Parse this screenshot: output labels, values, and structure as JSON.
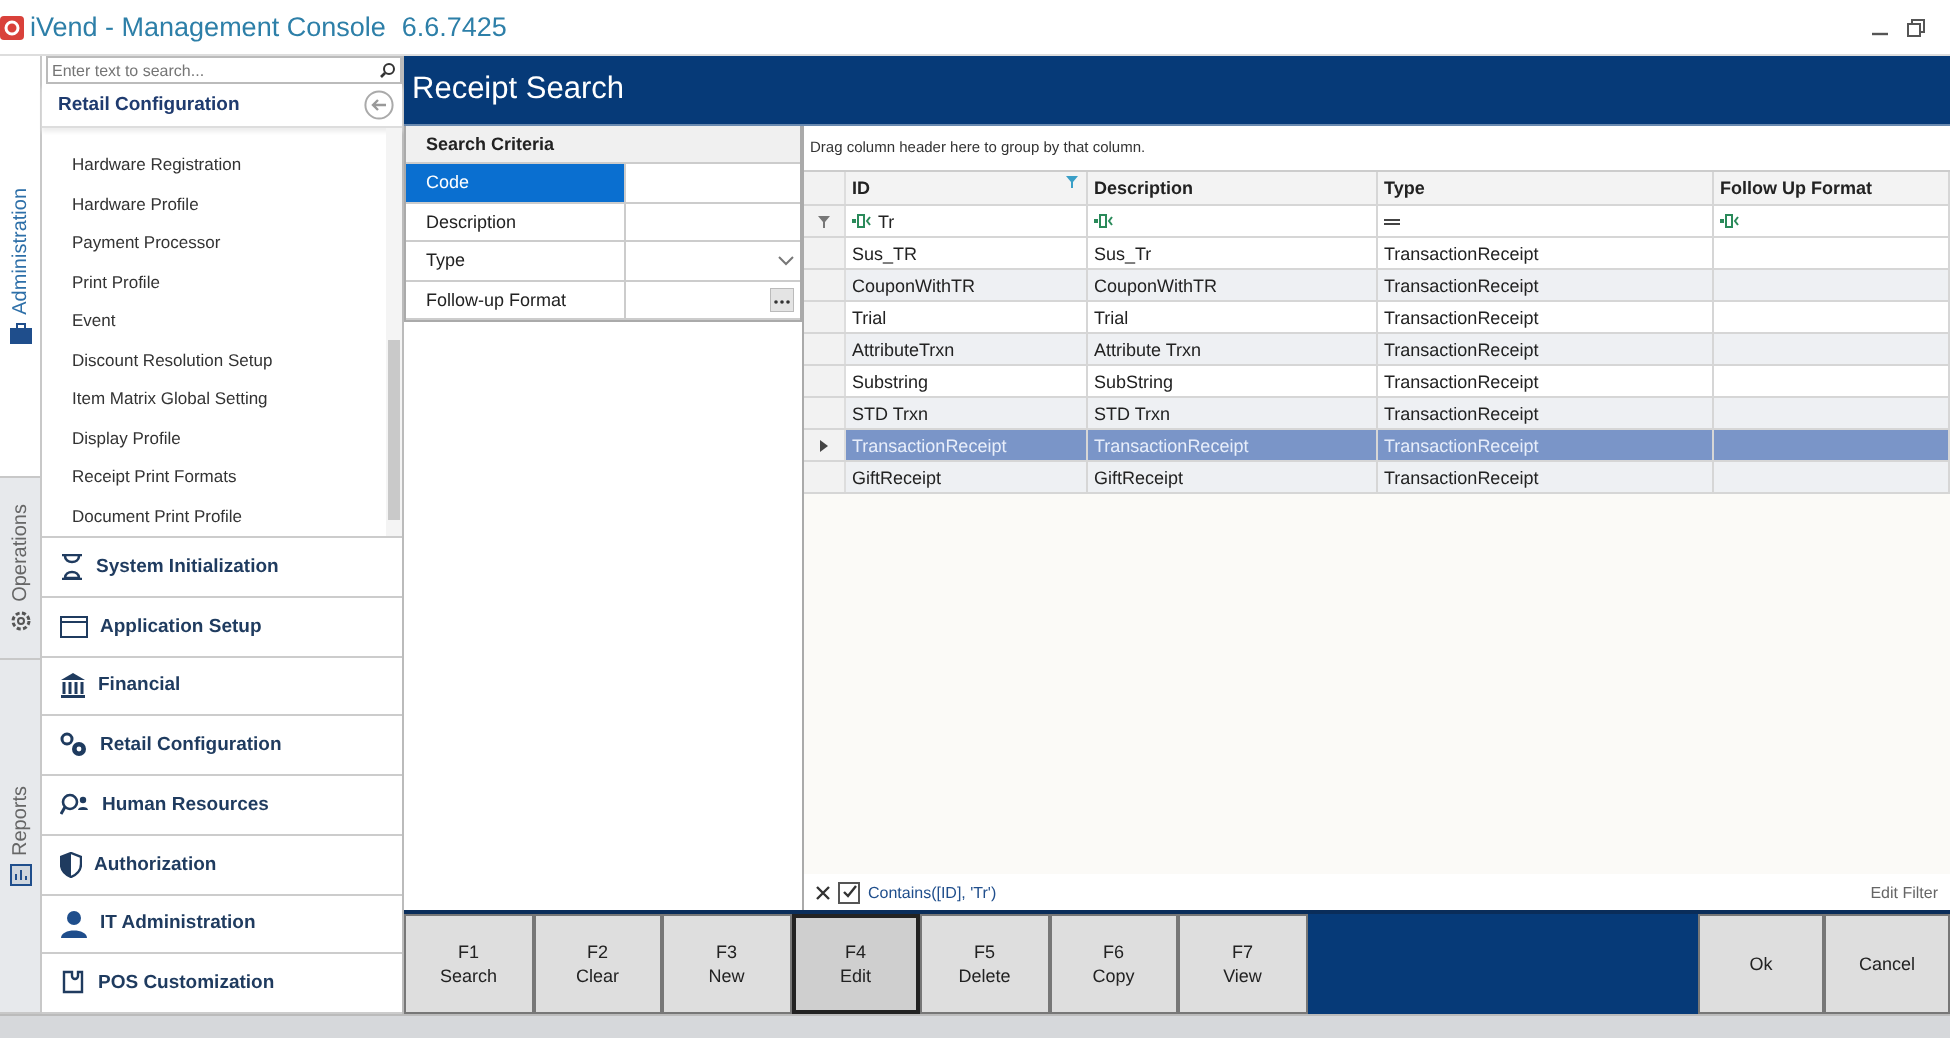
{
  "window": {
    "title": "iVend - Management Console",
    "version": "6.6.7425"
  },
  "side_tabs": [
    {
      "label": "Administration",
      "selected": true
    },
    {
      "label": "Operations",
      "selected": false
    },
    {
      "label": "Reports",
      "selected": false
    }
  ],
  "sidebar": {
    "search": {
      "placeholder": "Enter text to search..."
    },
    "section_title": "Retail Configuration",
    "items": [
      {
        "label": "Hardware Registration"
      },
      {
        "label": "Hardware Profile"
      },
      {
        "label": "Payment Processor"
      },
      {
        "label": "Print Profile"
      },
      {
        "label": "Event"
      },
      {
        "label": "Discount Resolution Setup"
      },
      {
        "label": "Item Matrix Global Setting"
      },
      {
        "label": "Display Profile"
      },
      {
        "label": "Receipt Print Formats"
      },
      {
        "label": "Document Print Profile"
      }
    ],
    "groups": [
      {
        "label": "System Initialization"
      },
      {
        "label": "Application Setup"
      },
      {
        "label": "Financial"
      },
      {
        "label": "Retail Configuration"
      },
      {
        "label": "Human Resources"
      },
      {
        "label": "Authorization"
      },
      {
        "label": "IT Administration"
      },
      {
        "label": "POS Customization"
      }
    ]
  },
  "page": {
    "title": "Receipt Search"
  },
  "criteria": {
    "title": "Search Criteria",
    "fields": [
      {
        "label": "Code",
        "kind": "text",
        "selected": true
      },
      {
        "label": "Description",
        "kind": "text",
        "selected": false
      },
      {
        "label": "Type",
        "kind": "dropdown",
        "selected": false
      },
      {
        "label": "Follow-up Format",
        "kind": "picker",
        "selected": false
      }
    ]
  },
  "grid": {
    "group_hint": "Drag column header here to group by that column.",
    "columns": [
      {
        "label": "ID",
        "filtered": true
      },
      {
        "label": "Description",
        "filtered": false
      },
      {
        "label": "Type",
        "filtered": false
      },
      {
        "label": "Follow Up Format",
        "filtered": false
      }
    ],
    "filter_row": [
      {
        "kind": "contains",
        "value": "Tr"
      },
      {
        "kind": "contains"
      },
      {
        "kind": "equals"
      },
      {
        "kind": "contains"
      }
    ],
    "rows": [
      {
        "id": "Sus_TR",
        "description": "Sus_Tr",
        "type": "TransactionReceipt",
        "selected": false
      },
      {
        "id": "CouponWithTR",
        "description": "CouponWithTR",
        "type": "TransactionReceipt",
        "selected": false
      },
      {
        "id": "Trial",
        "description": "Trial",
        "type": "TransactionReceipt",
        "selected": false
      },
      {
        "id": "AttributeTrxn",
        "description": "Attribute Trxn",
        "type": "TransactionReceipt",
        "selected": false
      },
      {
        "id": "Substring",
        "description": "SubString",
        "type": "TransactionReceipt",
        "selected": false
      },
      {
        "id": "STD Trxn",
        "description": "STD Trxn",
        "type": "TransactionReceipt",
        "selected": false
      },
      {
        "id": "TransactionReceipt",
        "description": "TransactionReceipt",
        "type": "TransactionReceipt",
        "selected": true
      },
      {
        "id": "GiftReceipt",
        "description": "GiftReceipt",
        "type": "TransactionReceipt",
        "selected": false
      }
    ],
    "filter": {
      "expression": "Contains([ID], 'Tr')",
      "enabled": true,
      "edit_label": "Edit Filter"
    }
  },
  "function_keys": [
    {
      "key": "F1",
      "label": "Search",
      "pressed": false
    },
    {
      "key": "F2",
      "label": "Clear",
      "pressed": false
    },
    {
      "key": "F3",
      "label": "New",
      "pressed": false
    },
    {
      "key": "F4",
      "label": "Edit",
      "pressed": true
    },
    {
      "key": "F5",
      "label": "Delete",
      "pressed": false
    },
    {
      "key": "F6",
      "label": "Copy",
      "pressed": false
    },
    {
      "key": "F7",
      "label": "View",
      "pressed": false
    }
  ],
  "dialog_buttons": [
    "Ok",
    "Cancel"
  ]
}
